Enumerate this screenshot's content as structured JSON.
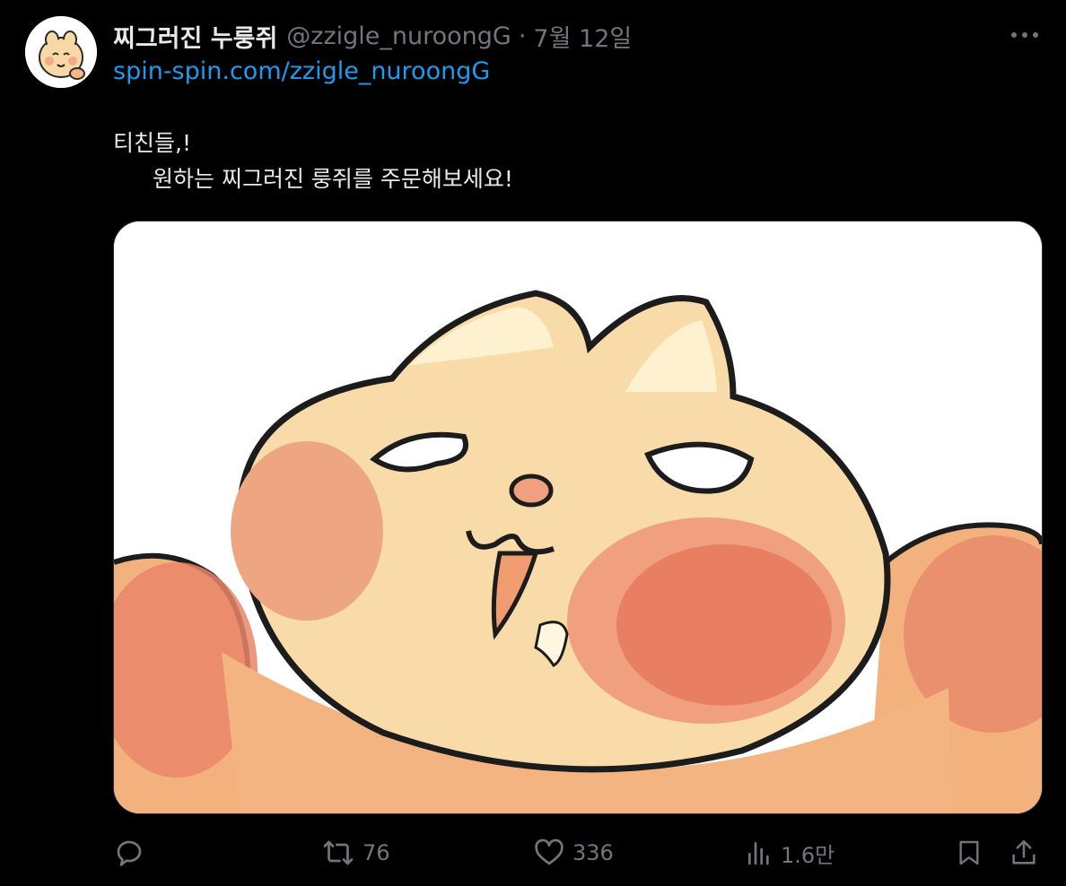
{
  "post": {
    "display_name": "찌그러진 누룽쥐",
    "handle": "@zzigle_nuroongG",
    "separator": "·",
    "date": "7월 12일",
    "link": "spin-spin.com/zzigle_nuroongG",
    "text_line1": "티친들,!",
    "text_line2": "원하는 찌그러진 룽쥐를 주문해보세요!"
  },
  "actions": {
    "retweets": "76",
    "likes": "336",
    "views": "1.6만"
  },
  "icons": {
    "more": "more-icon",
    "reply": "reply-icon",
    "retweet": "retweet-icon",
    "like": "heart-icon",
    "views": "views-icon",
    "bookmark": "bookmark-icon",
    "share": "share-icon"
  },
  "colors": {
    "background": "#000000",
    "text": "#e7e9ea",
    "muted": "#71767b",
    "link": "#1d9bf0"
  }
}
